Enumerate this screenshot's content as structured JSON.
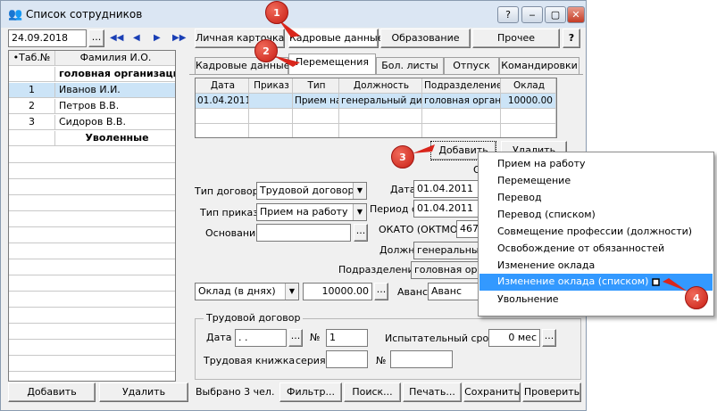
{
  "window": {
    "title": "Список сотрудников",
    "icon": "people-icon",
    "controls": {
      "help": "?",
      "minimize": "‒",
      "maximize": "▢",
      "close": "✕"
    }
  },
  "toolbar": {
    "date": "24.09.2018",
    "date_btn": "...",
    "nav": [
      "◀◀",
      "◀",
      "▶",
      "▶▶"
    ],
    "tabs": [
      "Личная карточка",
      "Кадровые данные",
      "Образование",
      "Прочее"
    ],
    "help": "?"
  },
  "left_table": {
    "columns": [
      "•Таб.№",
      "Фамилия И.О."
    ],
    "rows": [
      {
        "num": "",
        "name": "головная организация",
        "bold": true
      },
      {
        "num": "1",
        "name": "Иванов И.И.",
        "selected": true
      },
      {
        "num": "2",
        "name": "Петров В.В."
      },
      {
        "num": "3",
        "name": "Сидоров В.В."
      },
      {
        "num": "",
        "name": "Уволенные",
        "bold": true
      }
    ]
  },
  "subtabs": [
    "Кадровые данные",
    "Перемещения",
    "Бол. листы",
    "Отпуск",
    "Командировки"
  ],
  "grid": {
    "columns": [
      "Дата",
      "Приказ",
      "Тип",
      "Должность",
      "Подразделение",
      "Оклад"
    ],
    "rows": [
      [
        "01.04.2011",
        "",
        "Прием на",
        "генеральный дир",
        "головная организ",
        "10000.00"
      ]
    ]
  },
  "actions": {
    "add": "Добавить",
    "delete": "Удалить",
    "o_label": "О"
  },
  "form": {
    "contract_type_label": "Тип договора",
    "contract_type_value": "Трудовой договор",
    "order_type_label": "Тип приказа",
    "order_type_value": "Прием на работу",
    "basis_label": "Основание",
    "basis_btn": "...",
    "date_label": "Дата",
    "date_value": "01.04.2011",
    "period_label": "Период с",
    "period_value": "01.04.2011",
    "okato_label": "ОКАТО (ОКТМО)",
    "okato_value": "467",
    "position_label": "Должн.",
    "position_value": "генеральный",
    "dept_label": "Подразделение",
    "dept_value": "головная орг",
    "salary_type_value": "Оклад (в днях)",
    "salary_value": "10000.00",
    "salary_btn": "...",
    "advance_label": "Аванс",
    "advance_value": "Аванс"
  },
  "contract": {
    "group_label": "Трудовой договор",
    "date_label": "Дата",
    "date_value": " .  .",
    "date_btn": "...",
    "num_label": "№",
    "num_value": "1",
    "trial_label": "Испытательный срок",
    "trial_value": "0 мес",
    "trial_btn": "...",
    "book_label": "Трудовая книжка",
    "series_label": "серия",
    "book_num_label": "№"
  },
  "bottom": {
    "add": "Добавить",
    "delete": "Удалить",
    "status": "Выбрано 3 чел.",
    "filter": "Фильтр...",
    "search": "Поиск...",
    "print": "Печать...",
    "save": "Сохранить",
    "check": "Проверить"
  },
  "popup_menu": {
    "items": [
      "Прием на работу",
      "Перемещение",
      "Перевод",
      "Перевод (списком)",
      "Совмещение профессии (должности)",
      "Освобождение от обязанностей",
      "Изменение оклада",
      "Изменение оклада (списком)",
      "Увольнение"
    ],
    "selected_index": 7
  },
  "callouts": [
    "1",
    "2",
    "3",
    "4"
  ],
  "colors": {
    "selection": "#3399ff",
    "row_highlight": "#cce4f7",
    "callout": "#d9261c"
  }
}
